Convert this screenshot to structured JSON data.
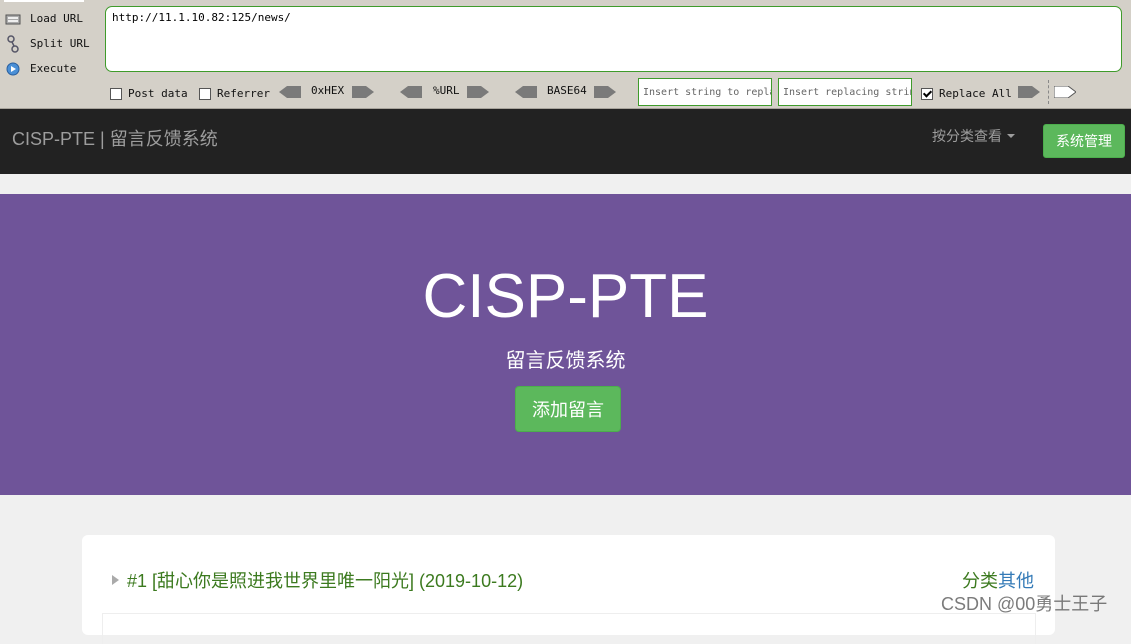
{
  "hackbar": {
    "actions": [
      {
        "label": "Load URL",
        "icon": "load-url-icon"
      },
      {
        "label": "Split URL",
        "icon": "split-url-icon"
      },
      {
        "label": "Execute",
        "icon": "execute-icon"
      }
    ],
    "url": "http://11.1.10.82:125/news/",
    "post_data_label": "Post data",
    "post_data_checked": false,
    "referrer_label": "Referrer",
    "referrer_checked": false,
    "hex_label": "0xHEX",
    "url_enc_label": "%URL",
    "base64_label": "BASE64",
    "insert_placeholder": "Insert string to replace",
    "replacing_placeholder": "Insert replacing string",
    "replace_all_label": "Replace All",
    "replace_all_checked": true
  },
  "navbar": {
    "brand": "CISP-PTE | 留言反馈系统",
    "category_dropdown": "按分类查看",
    "admin_button": "系统管理"
  },
  "jumbotron": {
    "title": "CISP-PTE",
    "subtitle": "留言反馈系统",
    "add_button": "添加留言"
  },
  "messages": [
    {
      "title": "#1 [甜心你是照进我世界里唯一阳光] (2019-10-12)",
      "category_label": "分类",
      "category_value": "其他"
    }
  ],
  "watermark": "CSDN @00勇士王子",
  "colors": {
    "jumbotron_bg": "#6f5499",
    "navbar_bg": "#222222",
    "success_green": "#5cb85c",
    "hackbar_bg": "#d4d0c8",
    "title_green": "#3c7a1f",
    "link_blue": "#337ab7"
  }
}
